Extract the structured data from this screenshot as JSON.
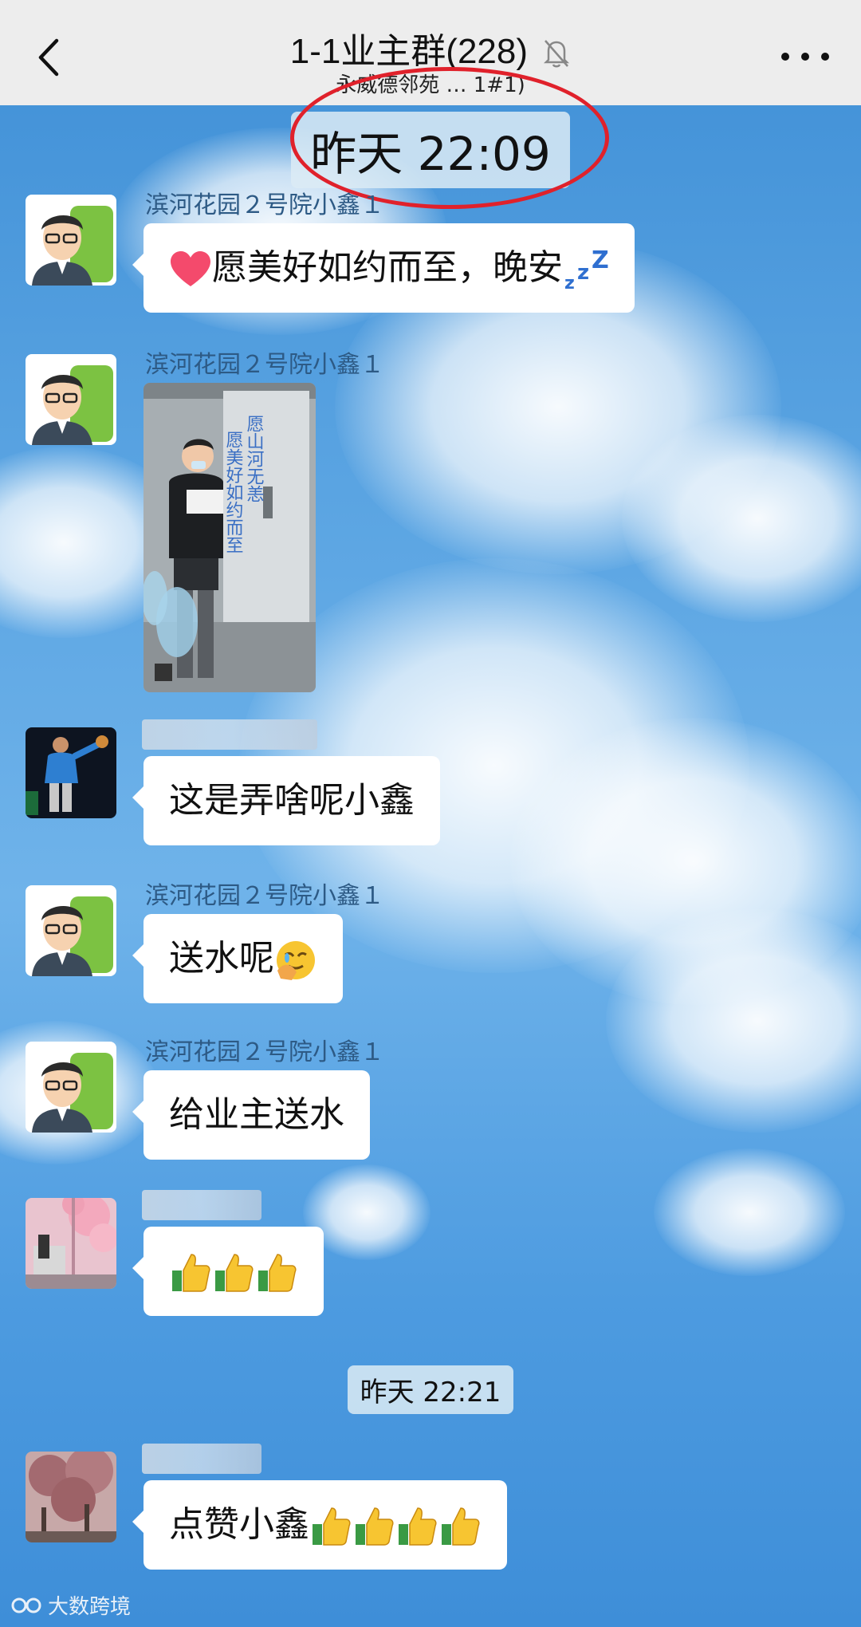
{
  "header": {
    "title": "1-1业主群(228)",
    "subtitle": "永威德邻苑 … 1#1)",
    "back_icon": "chevron-left-icon",
    "mute_icon": "bell-slash-icon",
    "more_icon": "more-dots-icon"
  },
  "timestamps": {
    "first": "昨天 22:09",
    "second": "昨天 22:21"
  },
  "messages": [
    {
      "sender": "滨河花园２号院小鑫１",
      "text": "愿美好如约而至，晚安",
      "kind": "text"
    },
    {
      "sender": "滨河花园２号院小鑫１",
      "kind": "image",
      "image_caption": "愿山河无恙 愿美好如约而至"
    },
    {
      "sender": "",
      "text": "这是弄啥呢小鑫",
      "kind": "text"
    },
    {
      "sender": "滨河花园２号院小鑫１",
      "text": "送水呢",
      "kind": "text"
    },
    {
      "sender": "滨河花园２号院小鑫１",
      "text": "给业主送水",
      "kind": "text"
    },
    {
      "sender": "",
      "text": "",
      "kind": "emoji",
      "emoji_count": 3
    },
    {
      "sender": "",
      "text": "点赞小鑫",
      "kind": "text",
      "emoji_count": 4
    }
  ],
  "watermark": "大数跨境",
  "colors": {
    "header_bg": "#ededed",
    "bubble_bg": "#ffffff",
    "highlight_ring": "#e0212b",
    "sender_name": "#2d5a85"
  }
}
